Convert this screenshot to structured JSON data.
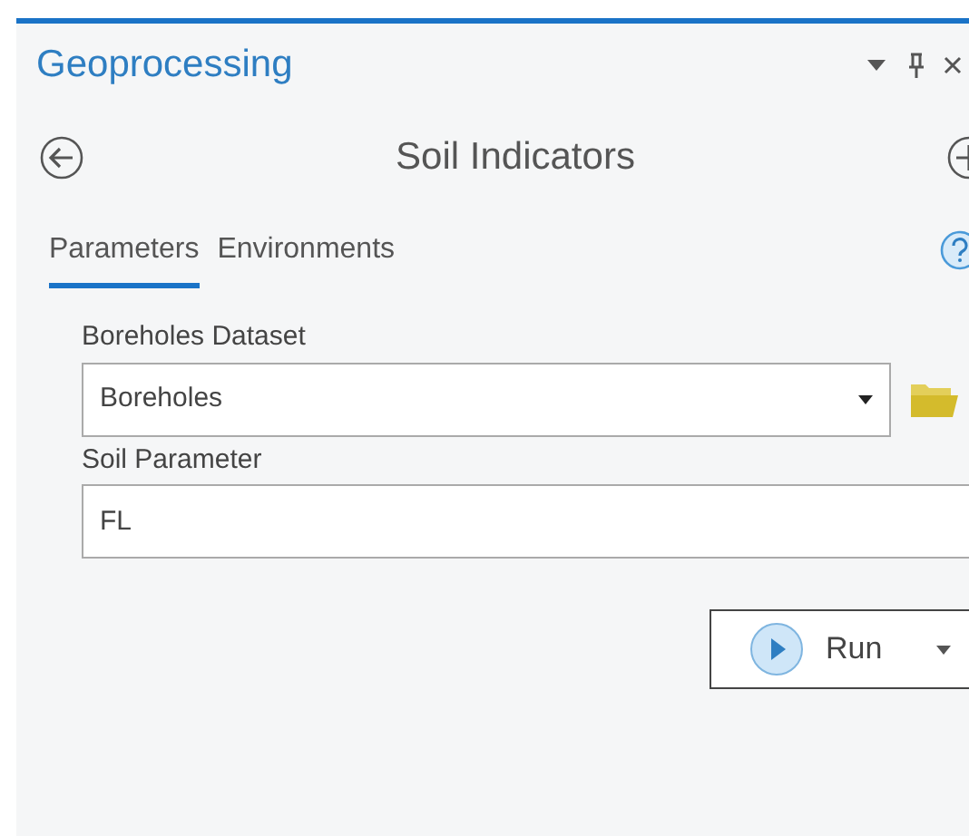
{
  "pane": {
    "title": "Geoprocessing"
  },
  "tool": {
    "title": "Soil Indicators"
  },
  "tabs": [
    {
      "label": "Parameters",
      "selected": true
    },
    {
      "label": "Environments",
      "selected": false
    }
  ],
  "parameters": [
    {
      "label": "Boreholes Dataset",
      "kind": "dropdown",
      "value": "Boreholes"
    },
    {
      "label": "Soil Parameter",
      "kind": "text",
      "value": "FL"
    }
  ],
  "run_button": {
    "label": "Run"
  }
}
